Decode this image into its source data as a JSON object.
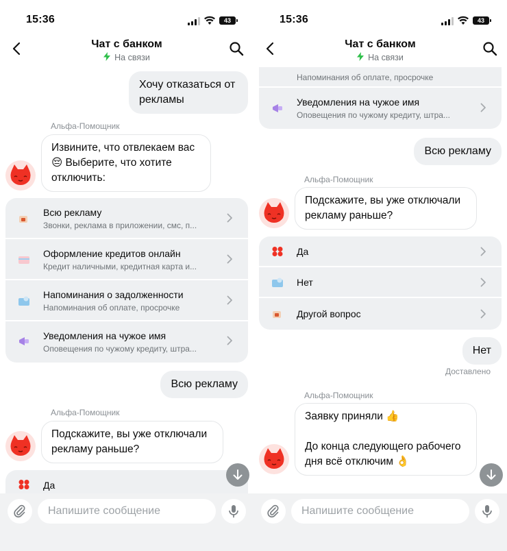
{
  "status": {
    "time": "15:36",
    "battery": "43"
  },
  "header": {
    "title": "Чат с банком",
    "subtitle": "На связи"
  },
  "chat_left": {
    "user_msg_1": "Хочу отказаться от рекламы",
    "sender_1": "Альфа-Помощник",
    "bot_msg_1_line1": "Извините, что отвлекаем вас",
    "bot_msg_1_line2": "😔 Выберите, что хотите",
    "bot_msg_1_line3": "отключить:",
    "options": [
      {
        "title": "Всю рекламу",
        "subtitle": "Звонки, реклама в приложении, смс, п...",
        "icon": "tea-cup-icon"
      },
      {
        "title": "Оформление кредитов онлайн",
        "subtitle": "Кредит наличными, кредитная карта и...",
        "icon": "card-icon"
      },
      {
        "title": "Напоминания о задолженности",
        "subtitle": "Напоминания об оплате, просрочке",
        "icon": "reminder-icon"
      },
      {
        "title": "Уведомления на чужое имя",
        "subtitle": "Оповещения по чужому кредиту, штра...",
        "icon": "megaphone-icon"
      }
    ],
    "user_msg_2": "Всю рекламу",
    "sender_2": "Альфа-Помощник",
    "bot_msg_2_line1": "Подскажите, вы уже отключали",
    "bot_msg_2_line2": "рекламу раньше?",
    "partial_option": "Да"
  },
  "chat_right": {
    "top_options": [
      {
        "subtitle": "Напоминания об оплате, просрочке",
        "icon": "reminder-icon"
      },
      {
        "title": "Уведомления на чужое имя",
        "subtitle": "Оповещения по чужому кредиту, штра...",
        "icon": "megaphone-icon"
      }
    ],
    "user_msg_1": "Всю рекламу",
    "sender_1": "Альфа-Помощник",
    "bot_msg_1_line1": "Подскажите, вы уже отключали",
    "bot_msg_1_line2": "рекламу раньше?",
    "options": [
      {
        "title": "Да",
        "icon": "clover-icon"
      },
      {
        "title": "Нет",
        "icon": "reminder-icon"
      },
      {
        "title": "Другой вопрос",
        "icon": "tea-cup-icon"
      }
    ],
    "user_msg_2": "Нет",
    "delivered": "Доставлено",
    "sender_2": "Альфа-Помощник",
    "bot_msg_2_line1": "Заявку приняли 👍",
    "bot_msg_2_line2": "До конца следующего рабочего",
    "bot_msg_2_line3": "дня всё отключим 👌"
  },
  "composer": {
    "placeholder": "Напишите сообщение"
  },
  "colors": {
    "bubble_out": "#eef0f2",
    "accent_red": "#ef3124",
    "online_green": "#2fbf4a",
    "fab": "#8e9396"
  }
}
